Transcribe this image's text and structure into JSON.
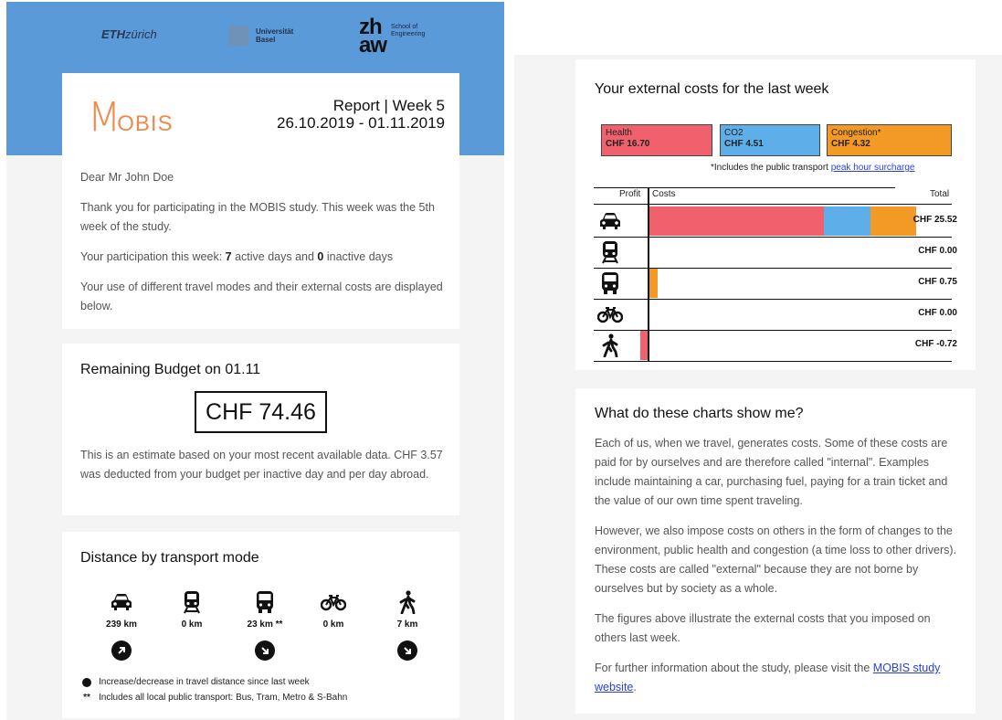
{
  "header": {
    "eth_logo_bold": "ETH",
    "eth_logo_rest": "zürich",
    "unibas_logo_line1": "Universität",
    "unibas_logo_line2": "Basel",
    "zhaw_logo_top": "zh",
    "zhaw_logo_bottom": "aw",
    "zhaw_logo_sub1": "School of",
    "zhaw_logo_sub2": "Engineering"
  },
  "report": {
    "brand_m": "M",
    "brand_rest": "OBIS",
    "title": "Report | Week 5",
    "date_range": "26.10.2019 - 01.11.2019",
    "greeting": "Dear Mr John Doe",
    "thanks": "Thank you for participating in the MOBIS study. This week was the 5th week of the study.",
    "participation_prefix": "Your participation this week: ",
    "active_days": "7",
    "active_label": " active days and ",
    "inactive_days": "0",
    "inactive_label": " inactive days",
    "usage_note": "Your use of different travel modes and their external costs are displayed below."
  },
  "budget": {
    "title": "Remaining Budget on 01.11",
    "amount": "CHF 74.46",
    "note": "This is an estimate based on your most recent available data. CHF 3.57 was deducted from your budget per inactive day and per day abroad."
  },
  "distance": {
    "title": "Distance by transport mode",
    "modes": [
      {
        "icon": "car-icon",
        "km": "239 km",
        "trend": "up"
      },
      {
        "icon": "train-icon",
        "km": "0 km",
        "trend": "none"
      },
      {
        "icon": "bus-icon",
        "km": "23 km **",
        "trend": "down"
      },
      {
        "icon": "bicycle-icon",
        "km": "0 km",
        "trend": "none"
      },
      {
        "icon": "walking-icon",
        "km": "7 km",
        "trend": "down"
      }
    ],
    "legend_trend": "Increase/decrease in travel distance since last week",
    "legend_asterisk_mark": "**",
    "legend_asterisk": "Includes all local public transport: Bus, Tram, Metro & S-Bahn"
  },
  "costs": {
    "title": "Your external costs for the last week",
    "categories": [
      {
        "name": "Health",
        "value": "CHF 16.70",
        "color": "#f0616d"
      },
      {
        "name": "CO2",
        "value": "CHF 4.51",
        "color": "#5eaeea"
      },
      {
        "name": "Congestion*",
        "value": "CHF 4.32",
        "color": "#f39a26"
      }
    ],
    "surcharge_prefix": "*Includes the public transport ",
    "surcharge_link": "peak hour surcharge",
    "col_profit": "Profit",
    "col_costs": "Costs",
    "col_total": "Total",
    "rows": [
      {
        "icon": "car-icon",
        "health": 16.7,
        "co2": 4.51,
        "congestion": 4.32,
        "profit": 0,
        "total": "CHF 25.52"
      },
      {
        "icon": "train-icon",
        "health": 0,
        "co2": 0,
        "congestion": 0,
        "profit": 0,
        "total": "CHF 0.00"
      },
      {
        "icon": "bus-icon",
        "health": 0,
        "co2": 0,
        "congestion": 0.75,
        "profit": 0,
        "total": "CHF 0.75"
      },
      {
        "icon": "bicycle-icon",
        "health": 0,
        "co2": 0,
        "congestion": 0,
        "profit": 0,
        "total": "CHF 0.00"
      },
      {
        "icon": "walking-icon",
        "health": 0,
        "co2": 0,
        "congestion": 0,
        "profit": 0.72,
        "total": "CHF -0.72"
      }
    ]
  },
  "info": {
    "title": "What do these charts show me?",
    "p1": "Each of us, when we travel, generates costs. Some of these costs are paid for by ourselves and are therefore called \"internal\". Examples include maintaining a car, purchasing fuel, paying for a train ticket and the value of our own time spent traveling.",
    "p2": "However, we also impose costs on others in the form of changes to the environment, public health and congestion (a time loss to other drivers). These costs are called \"external\" because they are not borne by ourselves but by society as a whole.",
    "p3": "The figures above illustrate the external costs that you imposed on others last week.",
    "p4_prefix": "For further information about the study, please visit the ",
    "p4_link": "MOBIS study website",
    "p4_suffix": "."
  }
}
